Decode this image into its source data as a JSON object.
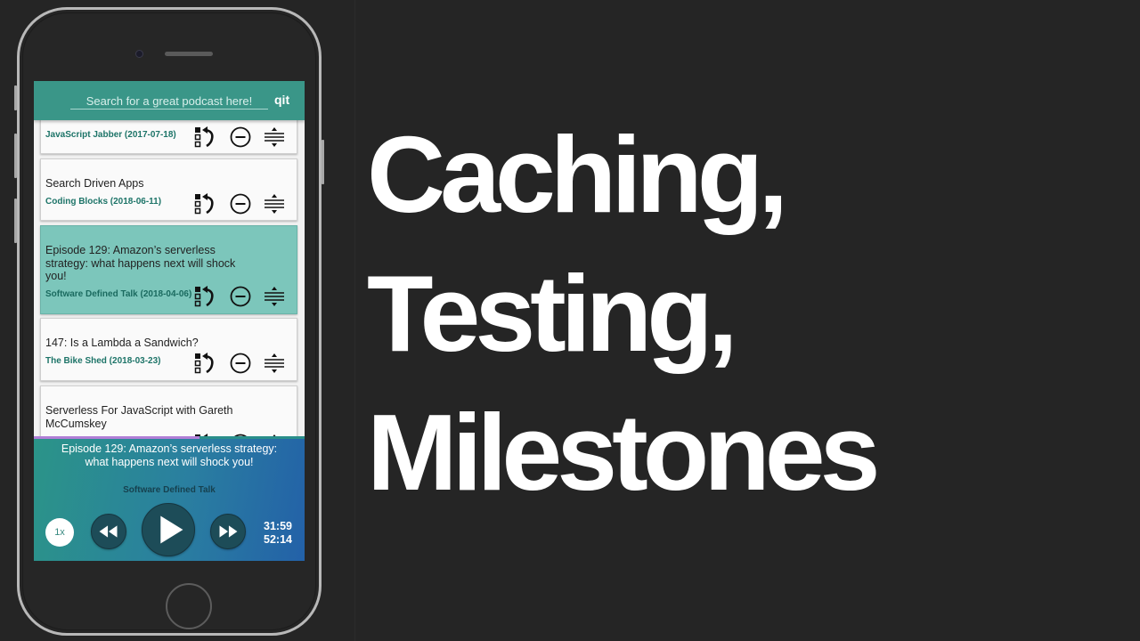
{
  "app": {
    "logo": "qit",
    "search": {
      "placeholder": "Search for a great podcast here!",
      "value": ""
    },
    "colors": {
      "header": "#3a9688",
      "active_card": "#7cc6bb",
      "subtitle": "#1d7468",
      "progress": "#b07ed6",
      "player_start": "#2b9488",
      "player_end": "#2361a8"
    }
  },
  "queue": {
    "item_icons": [
      "move-to-top-icon",
      "remove-icon",
      "reorder-icon"
    ],
    "items": [
      {
        "title": "",
        "subtitle": "JavaScript Jabber (2017-07-18)",
        "active": false
      },
      {
        "title": "Search Driven Apps",
        "subtitle": "Coding Blocks (2018-06-11)",
        "active": false
      },
      {
        "title": "Episode 129: Amazon’s serverless strategy: what happens next will shock you!",
        "subtitle": "Software Defined Talk (2018-04-06)",
        "active": true
      },
      {
        "title": "147: Is a Lambda a Sandwich?",
        "subtitle": "The Bike Shed (2018-03-23)",
        "active": false
      },
      {
        "title": "Serverless For JavaScript with Gareth McCumskey",
        "subtitle": "",
        "active": false
      }
    ]
  },
  "player": {
    "title": "Episode 129: Amazon’s serverless strategy: what happens next will shock you!",
    "show": "Software Defined Talk",
    "speed_label": "1x",
    "elapsed": "31:59",
    "duration": "52:14",
    "progress_fraction": 0.612,
    "buttons": [
      "rewind-icon",
      "play-icon",
      "fast-forward-icon"
    ]
  },
  "headline": {
    "lines": [
      "Caching,",
      "Testing,",
      "Milestones"
    ]
  }
}
